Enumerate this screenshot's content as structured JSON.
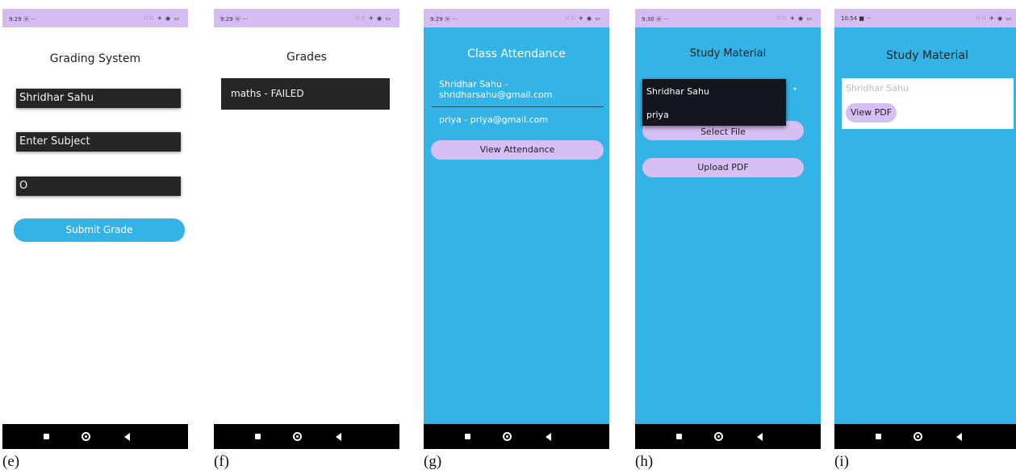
{
  "status_bar_icons": "⁙⁙ ✈ ◉ ▭",
  "screens": [
    {
      "caption": "(e)",
      "time": "9:29 ⓦ ···",
      "title": "Grading System",
      "name_field": "Shridhar Sahu",
      "subject_field": "Enter Subject",
      "grade_field": "O",
      "submit_button": "Submit Grade"
    },
    {
      "caption": "(f)",
      "time": "9:29 ⓦ ···",
      "title": "Grades",
      "grade_item": "maths - FAILED"
    },
    {
      "caption": "(g)",
      "time": "9:29 ⓦ ···",
      "title": "Class Attendance",
      "students": [
        "Shridhar Sahu - shridharsahu@gmail.com",
        "priya - priya@gmail.com"
      ],
      "view_button": "View Attendance"
    },
    {
      "caption": "(h)",
      "time": "9:30 ⓦ ···",
      "title": "Study Material",
      "dropdown_options": [
        "Shridhar Sahu",
        "priya"
      ],
      "select_button": "Select File",
      "upload_button": "Upload PDF"
    },
    {
      "caption": "(i)",
      "time": "10:54 ■ ···",
      "title": "Study Material",
      "student_name": "Shridhar Sahu",
      "view_pdf_button": "View PDF"
    }
  ]
}
